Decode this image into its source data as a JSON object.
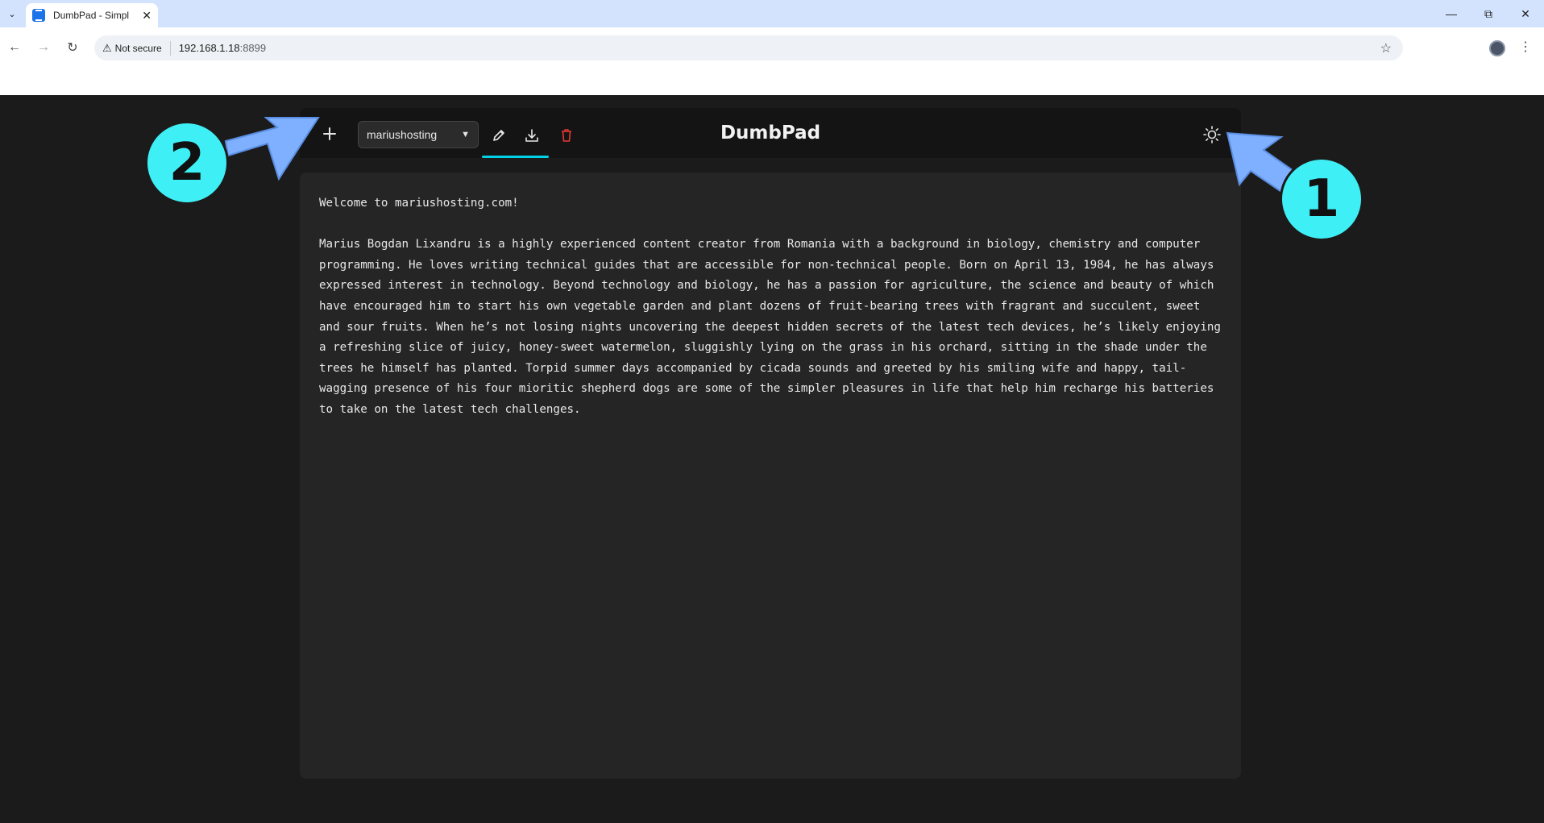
{
  "browser": {
    "tab_title": "DumbPad - Simpl",
    "security_label": "Not secure",
    "url_host": "192.168.1.18",
    "url_port": ":8899"
  },
  "app": {
    "title": "DumbPad",
    "notepad_selected": "mariushosting",
    "icons": {
      "new": "plus-icon",
      "rename": "pencil-icon",
      "download": "download-icon",
      "delete": "trash-icon",
      "theme": "sun-icon"
    },
    "delete_color": "#e53935",
    "accent_color": "#00d1e6",
    "content": "Welcome to mariushosting.com!\n\nMarius Bogdan Lixandru is a highly experienced content creator from Romania with a background in biology, chemistry and computer programming. He loves writing technical guides that are accessible for non-technical people. Born on April 13, 1984, he has always expressed interest in technology. Beyond technology and biology, he has a passion for agriculture, the science and beauty of which have encouraged him to start his own vegetable garden and plant dozens of fruit-bearing trees with fragrant and succulent, sweet and sour fruits. When he’s not losing nights uncovering the deepest hidden secrets of the latest tech devices, he’s likely enjoying a refreshing slice of juicy, honey-sweet watermelon, sluggishly lying on the grass in his orchard, sitting in the shade under the trees he himself has planted. Torpid summer days accompanied by cicada sounds and greeted by his smiling wife and happy, tail-wagging presence of his four mioritic shepherd dogs are some of the simpler pleasures in life that help him recharge his batteries to take on the latest tech challenges."
  },
  "annotations": {
    "badge_1": "1",
    "badge_2": "2",
    "badge_color": "#3ef0f5",
    "arrow_color": "#7fb0ff"
  }
}
